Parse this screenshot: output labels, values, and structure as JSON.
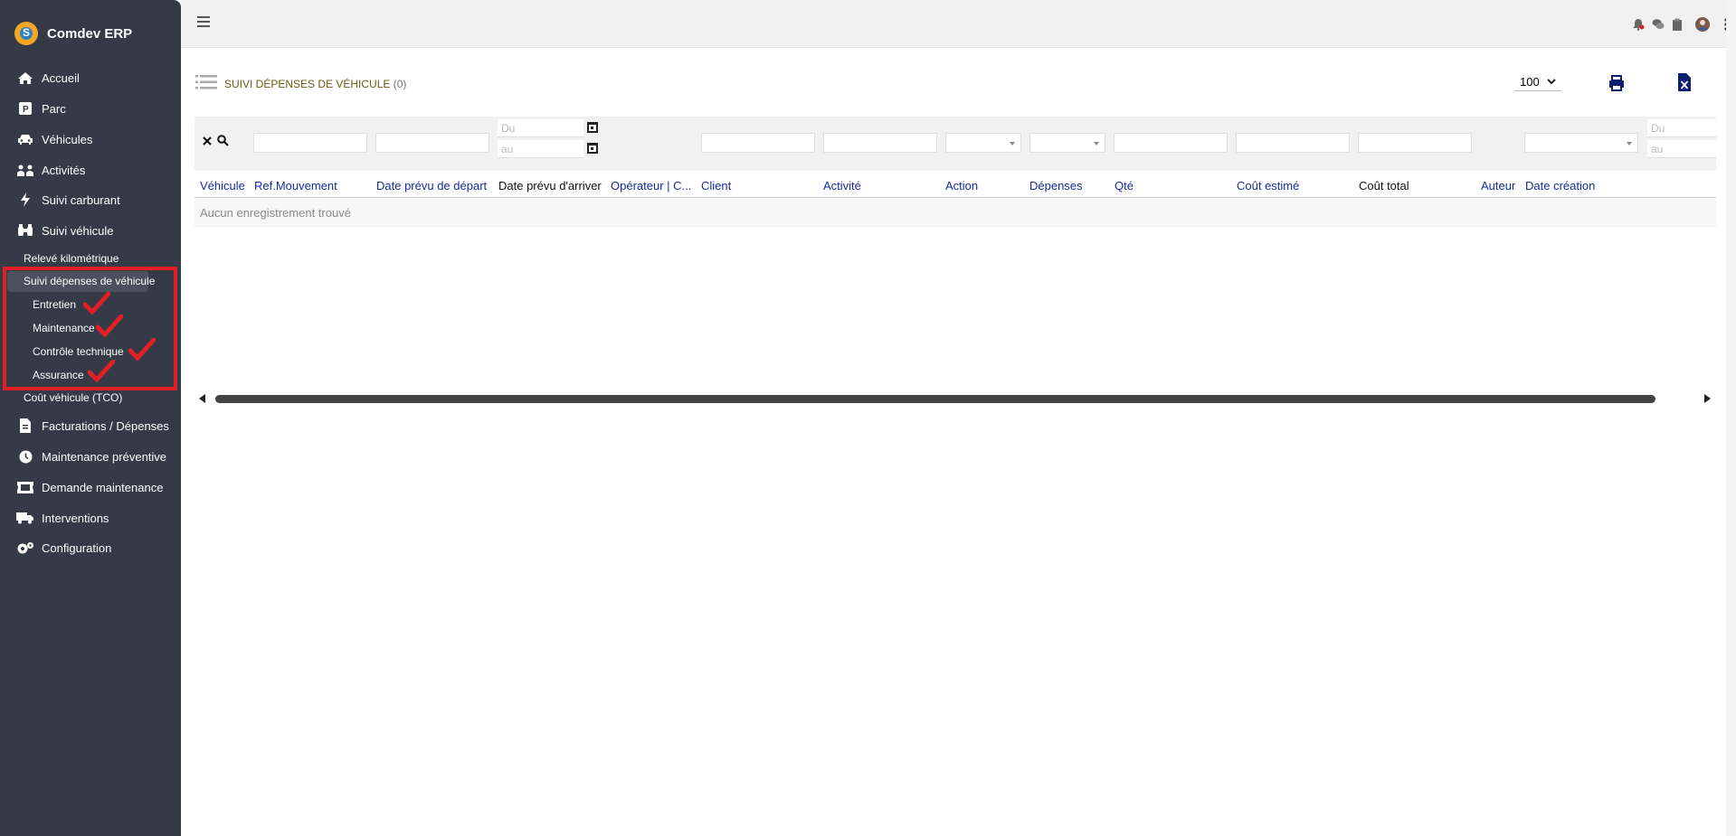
{
  "app": {
    "name": "Comdev ERP"
  },
  "sidebar": {
    "items": [
      {
        "label": "Accueil",
        "icon": "home-icon"
      },
      {
        "label": "Parc",
        "icon": "parking-icon"
      },
      {
        "label": "Véhicules",
        "icon": "car-icon"
      },
      {
        "label": "Activités",
        "icon": "people-icon"
      },
      {
        "label": "Suivi carburant",
        "icon": "bolt-icon"
      },
      {
        "label": "Suivi véhicule",
        "icon": "binoculars-icon"
      },
      {
        "label": "Facturations / Dépenses",
        "icon": "invoice-icon"
      },
      {
        "label": "Maintenance préventive",
        "icon": "clock-icon"
      },
      {
        "label": "Demande maintenance",
        "icon": "ticket-icon"
      },
      {
        "label": "Interventions",
        "icon": "truck-icon"
      },
      {
        "label": "Configuration",
        "icon": "gears-icon"
      }
    ],
    "suivi_vehicule_sub": [
      "Relevé kilométrique",
      "Suivi dépenses de véhicule",
      "Coût véhicule (TCO)"
    ],
    "depenses_sub": [
      "Entretien",
      "Maintenance",
      "Contrôle technique",
      "Assurance"
    ],
    "highlight_color": "#e01f26"
  },
  "page": {
    "title": "Suivi dépenses de véhicule",
    "count": "(0)",
    "rows_per_page": "100"
  },
  "filters": {
    "date_from_placeholder": "Du",
    "date_to_placeholder": "au"
  },
  "table": {
    "columns": [
      "Véhicule",
      "Ref.Mouvement",
      "Date prévu de départ",
      "Date prévu d'arriver",
      "Opérateur | C...",
      "Client",
      "Activité",
      "Action",
      "Dépenses",
      "Qté",
      "Coût estimé",
      "Coût total",
      "Auteur",
      "Date création"
    ],
    "empty_message": "Aucun enregistrement trouvé"
  },
  "colors": {
    "sidebar_bg": "#343a46",
    "header_link": "#1a2a9c",
    "title": "#6b5a10"
  }
}
